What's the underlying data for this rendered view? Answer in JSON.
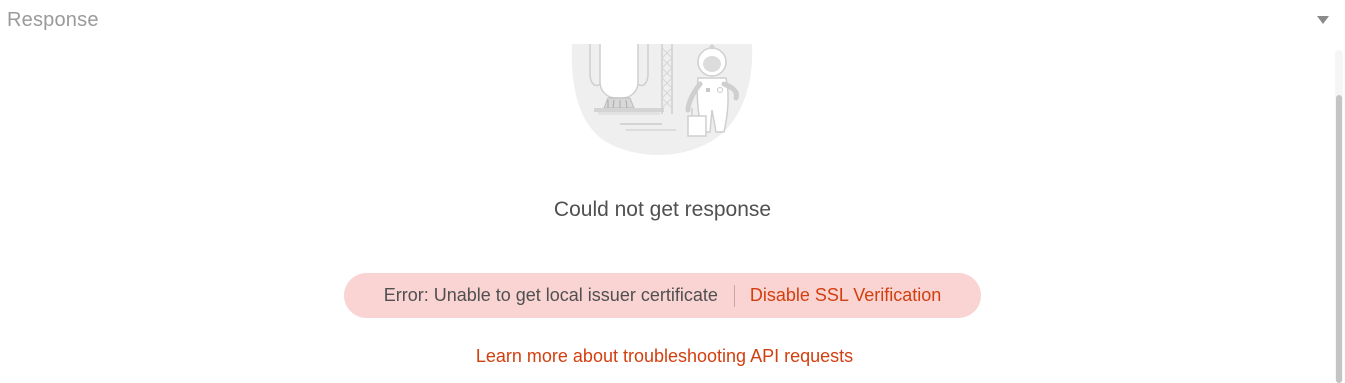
{
  "header": {
    "title": "Response",
    "collapse_icon": "chevron-down-icon"
  },
  "empty_state": {
    "illustration_icon": "astronaut-rocket-illustration",
    "message": "Could not get response"
  },
  "error": {
    "text": "Error: Unable to get local issuer certificate",
    "action_label": "Disable SSL Verification"
  },
  "help": {
    "link_label": "Learn more about troubleshooting API requests"
  },
  "colors": {
    "accent": "#d23f0e",
    "error_background": "#fad3d3",
    "muted_text": "#9a9a9a",
    "body_text": "#505050"
  }
}
